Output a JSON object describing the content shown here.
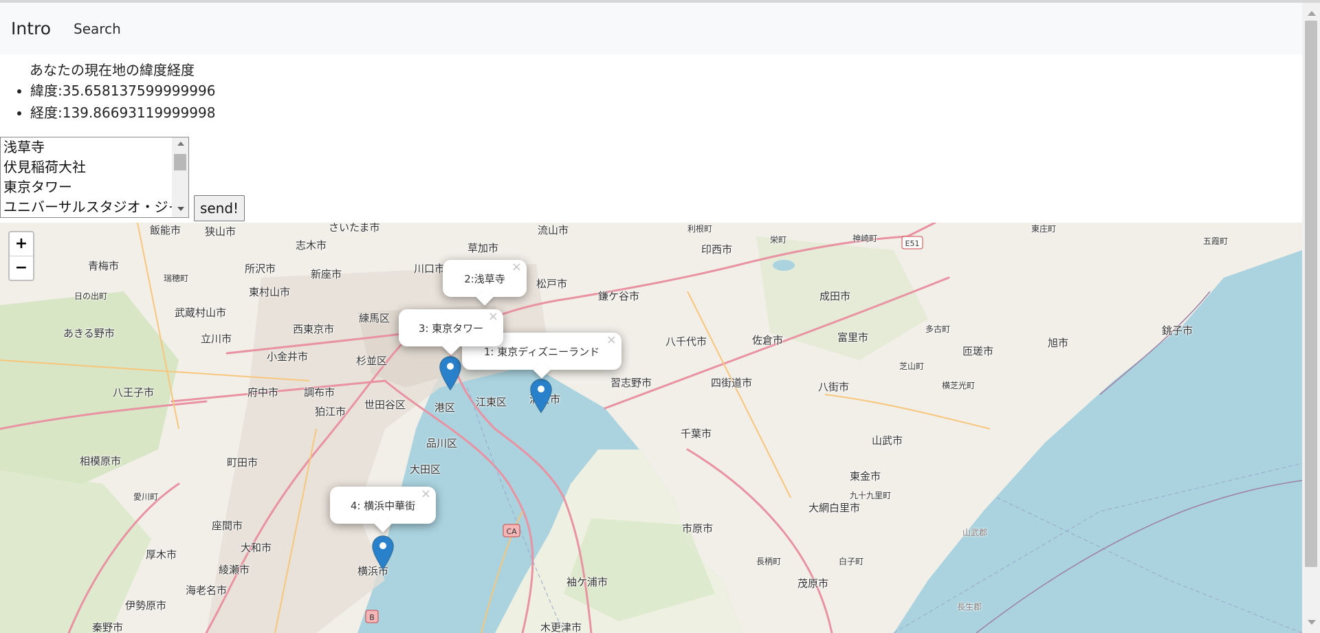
{
  "navbar": {
    "brand": "Intro",
    "search_link": "Search"
  },
  "location": {
    "title": "あなたの現在地の緯度経度",
    "latitude_text": "緯度:35.658137599999996",
    "longitude_text": "経度:139.86693119999998"
  },
  "place_select": {
    "options": [
      "浅草寺",
      "伏見稲荷大社",
      "東京タワー",
      "ユニバーサルスタジオ・ジャパン"
    ]
  },
  "send_button": "send!",
  "map": {
    "zoom_in": "+",
    "zoom_out": "−",
    "popups": [
      "2:浅草寺",
      "3: 東京タワー",
      "1: 東京ディズニーランド",
      "4: 横浜中華街"
    ],
    "close_glyph": "×",
    "marker_color": "#2a81cb",
    "labels": [
      "飯能市",
      "狭山市",
      "さいたま市",
      "流山市",
      "草加市",
      "志木市",
      "川口市",
      "松戸市",
      "印西市",
      "青梅市",
      "所沢市",
      "新座市",
      "東村山市",
      "瑞穂町",
      "日の出町",
      "武蔵村山市",
      "練馬区",
      "鎌ケ谷市",
      "成田市",
      "あきる野市",
      "西東京市",
      "立川市",
      "小金井市",
      "杉並区",
      "八千代市",
      "佐倉市",
      "富里市",
      "匝瑳市",
      "旭市",
      "銚子市",
      "八王子市",
      "府中市",
      "調布市",
      "世田谷区",
      "港区",
      "江東区",
      "浦安市",
      "習志野市",
      "四街道市",
      "八街市",
      "横芝光町",
      "狛江市",
      "品川区",
      "千葉市",
      "山武市",
      "相模原市",
      "町田市",
      "大田区",
      "東金市",
      "九十九里町",
      "愛川町",
      "座間市",
      "大和市",
      "大網白里市",
      "厚木市",
      "綾瀬市",
      "横浜市",
      "市原市",
      "茂原市",
      "海老名市",
      "伊勢原市",
      "袖ケ浦市",
      "木更津市",
      "秦野市",
      "多古町",
      "芝山町",
      "白子町",
      "長柄町",
      "長生郡",
      "山武郡",
      "東庄町",
      "利根町",
      "栄町",
      "神崎町",
      "五霞町"
    ]
  }
}
